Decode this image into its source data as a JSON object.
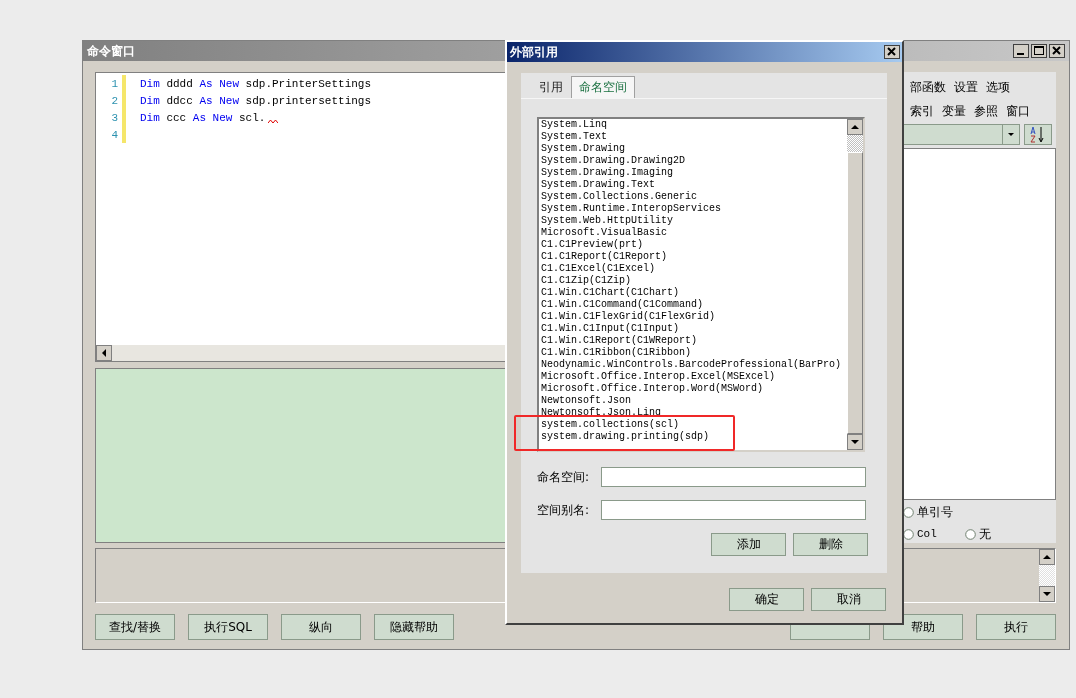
{
  "main_window": {
    "title": "命令窗口",
    "editor": {
      "lines": [
        {
          "number": "1",
          "tokens": [
            {
              "text": "Dim",
              "kind": "keyword"
            },
            {
              "text": "dddd",
              "kind": "plain"
            },
            {
              "text": "As",
              "kind": "keyword"
            },
            {
              "text": "New",
              "kind": "keyword"
            },
            {
              "text": "sdp.PrinterSettings",
              "kind": "plain"
            }
          ]
        },
        {
          "number": "2",
          "tokens": [
            {
              "text": "Dim",
              "kind": "keyword"
            },
            {
              "text": "ddcc",
              "kind": "plain"
            },
            {
              "text": "As",
              "kind": "keyword"
            },
            {
              "text": "New",
              "kind": "keyword"
            },
            {
              "text": "sdp.printersettings",
              "kind": "plain"
            }
          ]
        },
        {
          "number": "3",
          "error_mark": true,
          "tokens": [
            {
              "text": "Dim",
              "kind": "keyword"
            },
            {
              "text": "ccc",
              "kind": "plain"
            },
            {
              "text": "As",
              "kind": "keyword"
            },
            {
              "text": "New",
              "kind": "keyword"
            },
            {
              "text": "scl.",
              "kind": "plain"
            }
          ]
        },
        {
          "number": "4"
        }
      ]
    },
    "right_panel": {
      "menu_row_1": [
        "部函数",
        "设置",
        "选项"
      ],
      "menu_row_2": [
        "索引",
        "变量",
        "参照",
        "窗口"
      ],
      "radios": [
        {
          "label": "单引号",
          "selected": false
        },
        {
          "label": "Col",
          "selected": false
        },
        {
          "label": "无",
          "selected": false
        }
      ]
    },
    "buttons_left": [
      "查找/替换",
      "执行SQL",
      "纵向",
      "隐藏帮助"
    ],
    "buttons_right": [
      "帮助",
      "执行"
    ]
  },
  "dialog": {
    "title": "外部引用",
    "tabs": [
      {
        "label": "引用",
        "selected": false
      },
      {
        "label": "命名空间",
        "selected": true
      }
    ],
    "namespaces": [
      {
        "text": "System.Linq",
        "highlighted": false
      },
      {
        "text": "System.Text",
        "highlighted": false
      },
      {
        "text": "System.Drawing",
        "highlighted": false
      },
      {
        "text": "System.Drawing.Drawing2D",
        "highlighted": false
      },
      {
        "text": "System.Drawing.Imaging",
        "highlighted": false
      },
      {
        "text": "System.Drawing.Text",
        "highlighted": false
      },
      {
        "text": "System.Collections.Generic",
        "highlighted": false
      },
      {
        "text": "System.Runtime.InteropServices",
        "highlighted": false
      },
      {
        "text": "System.Web.HttpUtility",
        "highlighted": false
      },
      {
        "text": "Microsoft.VisualBasic",
        "highlighted": false
      },
      {
        "text": "C1.C1Preview(prt)",
        "highlighted": false
      },
      {
        "text": "C1.C1Report(C1Report)",
        "highlighted": false
      },
      {
        "text": "C1.C1Excel(C1Excel)",
        "highlighted": false
      },
      {
        "text": "C1.C1Zip(C1Zip)",
        "highlighted": false
      },
      {
        "text": "C1.Win.C1Chart(C1Chart)",
        "highlighted": false
      },
      {
        "text": "C1.Win.C1Command(C1Command)",
        "highlighted": false
      },
      {
        "text": "C1.Win.C1FlexGrid(C1FlexGrid)",
        "highlighted": false
      },
      {
        "text": "C1.Win.C1Input(C1Input)",
        "highlighted": false
      },
      {
        "text": "C1.Win.C1Report(C1WReport)",
        "highlighted": false
      },
      {
        "text": "C1.Win.C1Ribbon(C1Ribbon)",
        "highlighted": false
      },
      {
        "text": "Neodynamic.WinControls.BarcodeProfessional(BarPro)",
        "highlighted": false
      },
      {
        "text": "Microsoft.Office.Interop.Excel(MSExcel)",
        "highlighted": false
      },
      {
        "text": "Microsoft.Office.Interop.Word(MSWord)",
        "highlighted": false
      },
      {
        "text": "Newtonsoft.Json",
        "highlighted": false
      },
      {
        "text": "Newtonsoft.Json.Linq",
        "highlighted": false
      },
      {
        "text": "system.collections(scl)",
        "highlighted": true
      },
      {
        "text": "system.drawing.printing(sdp)",
        "highlighted": true
      }
    ],
    "fields": [
      {
        "label": "命名空间:"
      },
      {
        "label": "空间别名:"
      }
    ],
    "list_buttons": [
      "添加",
      "删除"
    ],
    "buttons": [
      "确定",
      "取消"
    ]
  }
}
